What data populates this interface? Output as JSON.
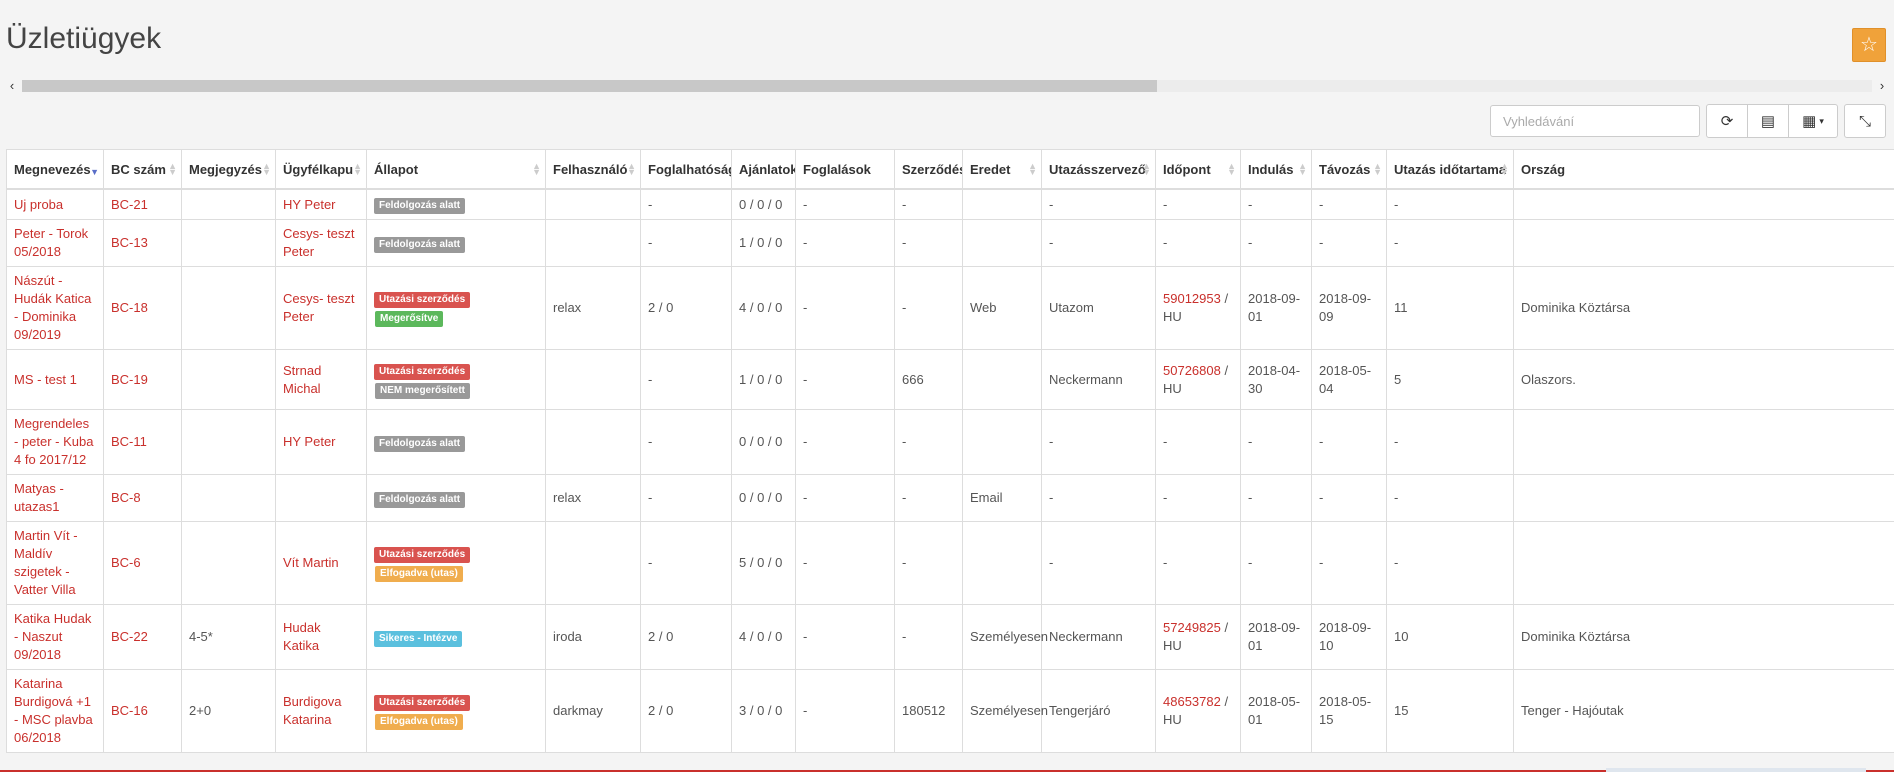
{
  "page": {
    "title": "Üzletiügyek"
  },
  "search": {
    "placeholder": "Vyhledávání"
  },
  "icons": {
    "favorite": "☆",
    "refresh": "⟳",
    "list": "▤",
    "columns": "▦",
    "caret": "▾",
    "collapse": "⤡",
    "scroll_left": "‹",
    "scroll_right": "›"
  },
  "table": {
    "columns": [
      {
        "key": "name",
        "label": "Megnevezés",
        "sort": "active"
      },
      {
        "key": "bc",
        "label": "BC szám",
        "sort": "both"
      },
      {
        "key": "note",
        "label": "Megjegyzés",
        "sort": "both"
      },
      {
        "key": "client",
        "label": "Ügyfélkapu",
        "sort": "both"
      },
      {
        "key": "status",
        "label": "Állapot",
        "sort": "both"
      },
      {
        "key": "user",
        "label": "Felhasználó",
        "sort": "both"
      },
      {
        "key": "avail",
        "label": "Foglalhatóság",
        "sort": "none"
      },
      {
        "key": "offers",
        "label": "Ajánlatok",
        "sort": "none"
      },
      {
        "key": "bookings",
        "label": "Foglalások",
        "sort": "none"
      },
      {
        "key": "contract",
        "label": "Szerződés",
        "sort": "none"
      },
      {
        "key": "source",
        "label": "Eredet",
        "sort": "both"
      },
      {
        "key": "organizer",
        "label": "Utazásszervező",
        "sort": "both"
      },
      {
        "key": "time",
        "label": "Időpont",
        "sort": "both"
      },
      {
        "key": "depart",
        "label": "Indulás",
        "sort": "both"
      },
      {
        "key": "return",
        "label": "Távozás",
        "sort": "both"
      },
      {
        "key": "duration",
        "label": "Utazás időtartama",
        "sort": "both"
      },
      {
        "key": "country",
        "label": "Ország",
        "sort": "none"
      }
    ],
    "rows": [
      {
        "name": "Uj proba",
        "bc": "BC-21",
        "note": "",
        "client": "HY Peter",
        "status": [
          {
            "text": "Feldolgozás alatt",
            "color": "gray"
          }
        ],
        "user": "",
        "avail": "-",
        "offers": "0 / 0 / 0",
        "bookings": "-",
        "contract": "-",
        "source": "",
        "organizer": "-",
        "time_link": "",
        "time_suffix": "-",
        "depart": "-",
        "return": "-",
        "duration": "-",
        "country": ""
      },
      {
        "name": "Peter - Torok 05/2018",
        "bc": "BC-13",
        "note": "",
        "client": "Cesys- teszt Peter",
        "status": [
          {
            "text": "Feldolgozás alatt",
            "color": "gray"
          }
        ],
        "user": "",
        "avail": "-",
        "offers": "1 / 0 / 0",
        "bookings": "-",
        "contract": "-",
        "source": "",
        "organizer": "-",
        "time_link": "",
        "time_suffix": "-",
        "depart": "-",
        "return": "-",
        "duration": "-",
        "country": ""
      },
      {
        "name": "Nászút - Hudák Katica - Dominika 09/2019",
        "bc": "BC-18",
        "note": "",
        "client": "Cesys- teszt Peter",
        "status": [
          {
            "text": "Utazási szerződés",
            "color": "red"
          },
          {
            "text": "Megerősítve",
            "color": "green"
          }
        ],
        "user": "relax",
        "avail": "2 / 0",
        "offers": "4 / 0 / 0",
        "bookings": "-",
        "contract": "-",
        "source": "Web",
        "organizer": "Utazom",
        "time_link": "59012953",
        "time_suffix": " / HU",
        "depart": "2018-09-01",
        "return": "2018-09-09",
        "duration": "11",
        "country": "Dominika Köztársa"
      },
      {
        "name": "MS - test 1",
        "bc": "BC-19",
        "note": "",
        "client": "Strnad Michal",
        "status": [
          {
            "text": "Utazási szerződés",
            "color": "red"
          },
          {
            "text": "NEM megerősített",
            "color": "gray"
          }
        ],
        "user": "",
        "avail": "-",
        "offers": "1 / 0 / 0",
        "bookings": "-",
        "contract": "666",
        "source": "",
        "organizer": "Neckermann",
        "time_link": "50726808",
        "time_suffix": " / HU",
        "depart": "2018-04-30",
        "return": "2018-05-04",
        "duration": "5",
        "country": "Olaszors."
      },
      {
        "name": "Megrendeles - peter - Kuba 4 fo 2017/12",
        "bc": "BC-11",
        "note": "",
        "client": "HY Peter",
        "status": [
          {
            "text": "Feldolgozás alatt",
            "color": "gray"
          }
        ],
        "user": "",
        "avail": "-",
        "offers": "0 / 0 / 0",
        "bookings": "-",
        "contract": "-",
        "source": "",
        "organizer": "-",
        "time_link": "",
        "time_suffix": "-",
        "depart": "-",
        "return": "-",
        "duration": "-",
        "country": ""
      },
      {
        "name": "Matyas - utazas1",
        "bc": "BC-8",
        "note": "",
        "client": "",
        "status": [
          {
            "text": "Feldolgozás alatt",
            "color": "gray"
          }
        ],
        "user": "relax",
        "avail": "-",
        "offers": "0 / 0 / 0",
        "bookings": "-",
        "contract": "-",
        "source": "Email",
        "organizer": "-",
        "time_link": "",
        "time_suffix": "-",
        "depart": "-",
        "return": "-",
        "duration": "-",
        "country": ""
      },
      {
        "name": "Martin Vít - Maldív szigetek - Vatter Villa",
        "bc": "BC-6",
        "note": "",
        "client": "Vít Martin",
        "status": [
          {
            "text": "Utazási szerződés",
            "color": "red"
          },
          {
            "text": "Elfogadva (utas)",
            "color": "orange"
          }
        ],
        "user": "",
        "avail": "-",
        "offers": "5 / 0 / 0",
        "bookings": "-",
        "contract": "-",
        "source": "",
        "organizer": "-",
        "time_link": "",
        "time_suffix": "-",
        "depart": "-",
        "return": "-",
        "duration": "-",
        "country": ""
      },
      {
        "name": "Katika Hudak - Naszut 09/2018",
        "bc": "BC-22",
        "note": "4-5*",
        "client": "Hudak Katika",
        "status": [
          {
            "text": "Sikeres - Intézve",
            "color": "blue"
          }
        ],
        "user": "iroda",
        "avail": "2 / 0",
        "offers": "4 / 0 / 0",
        "bookings": "-",
        "contract": "-",
        "source": "Személyesen",
        "organizer": "Neckermann",
        "time_link": "57249825",
        "time_suffix": " / HU",
        "depart": "2018-09-01",
        "return": "2018-09-10",
        "duration": "10",
        "country": "Dominika Köztársa"
      },
      {
        "name": "Katarina Burdigová +1 - MSC plavba 06/2018",
        "bc": "BC-16",
        "note": "2+0",
        "client": "Burdigova Katarina",
        "status": [
          {
            "text": "Utazási szerződés",
            "color": "red"
          },
          {
            "text": "Elfogadva (utas)",
            "color": "orange"
          }
        ],
        "user": "darkmay",
        "avail": "2 / 0",
        "offers": "3 / 0 / 0",
        "bookings": "-",
        "contract": "180512",
        "source": "Személyesen",
        "organizer": "Tengerjáró",
        "time_link": "48653782",
        "time_suffix": " / HU",
        "depart": "2018-05-01",
        "return": "2018-05-15",
        "duration": "15",
        "country": "Tenger - Hajóutak"
      }
    ]
  }
}
